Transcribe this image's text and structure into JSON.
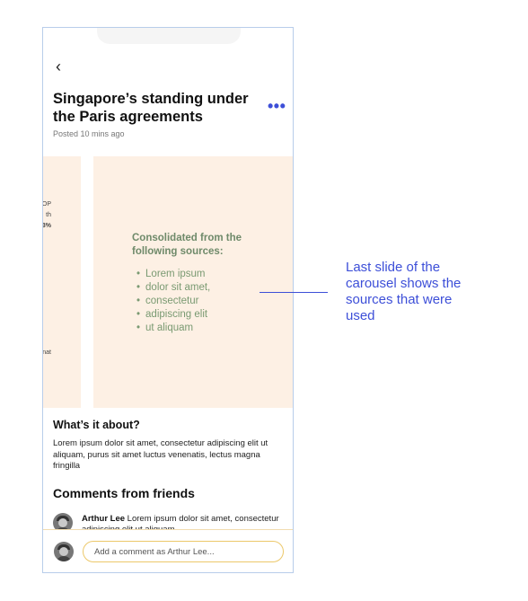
{
  "header": {
    "back_icon": "chevron-left-icon",
    "back_glyph": "‹",
    "title": "Singapore’s standing under the Paris agreements",
    "more_glyph": "•••",
    "posted": "Posted 10 mins ago"
  },
  "carousel": {
    "prev_fragments": [
      "OP",
      "th",
      "3%",
      "nat"
    ],
    "sources_title": "Consolidated from the following sources:",
    "sources": [
      "Lorem ipsum",
      "dolor sit amet,",
      "consectetur",
      "adipiscing elit",
      "ut aliquam"
    ]
  },
  "about": {
    "heading": "What’s it about?",
    "text": "Lorem ipsum dolor sit amet, consectetur adipiscing elit ut aliquam, purus sit amet luctus venenatis, lectus magna fringilla"
  },
  "comments": {
    "heading": "Comments from friends",
    "items": [
      {
        "author": "Arthur Lee",
        "text": " Lorem ipsum dolor sit amet, consectetur adipiscing elit ut aliquam"
      }
    ],
    "input_placeholder": "Add a comment as Arthur Lee..."
  },
  "annotation": {
    "text": "Last slide of the carousel shows the sources that were used"
  },
  "colors": {
    "accent": "#3d4fd8",
    "slide_bg": "#fdf0e4",
    "sources_green": "#6f8a6a",
    "input_border": "#ecc86a"
  }
}
